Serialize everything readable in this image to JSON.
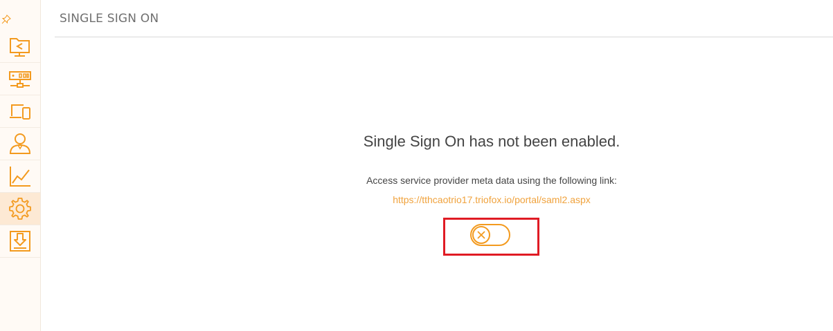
{
  "header": {
    "title": "SINGLE SIGN ON"
  },
  "sidebar": {
    "pin_icon": "pin-icon",
    "items": [
      {
        "icon": "shared-folder-icon",
        "active": false
      },
      {
        "icon": "server-network-icon",
        "active": false
      },
      {
        "icon": "devices-icon",
        "active": false
      },
      {
        "icon": "user-icon",
        "active": false
      },
      {
        "icon": "chart-icon",
        "active": false
      },
      {
        "icon": "gear-icon",
        "active": true
      },
      {
        "icon": "download-icon",
        "active": false
      }
    ]
  },
  "main": {
    "status_message": "Single Sign On has not been enabled.",
    "instruction": "Access service provider meta data using the following link:",
    "metadata_link": "https://tthcaotrio17.triofox.io/portal/saml2.aspx",
    "toggle": {
      "state": "off",
      "icon": "close-circle-icon"
    }
  },
  "colors": {
    "accent": "#f39a1e",
    "link": "#f0a23c",
    "highlight": "#e01b24",
    "sidebar_bg": "#fffaf5",
    "active_bg": "#fde9d4"
  }
}
